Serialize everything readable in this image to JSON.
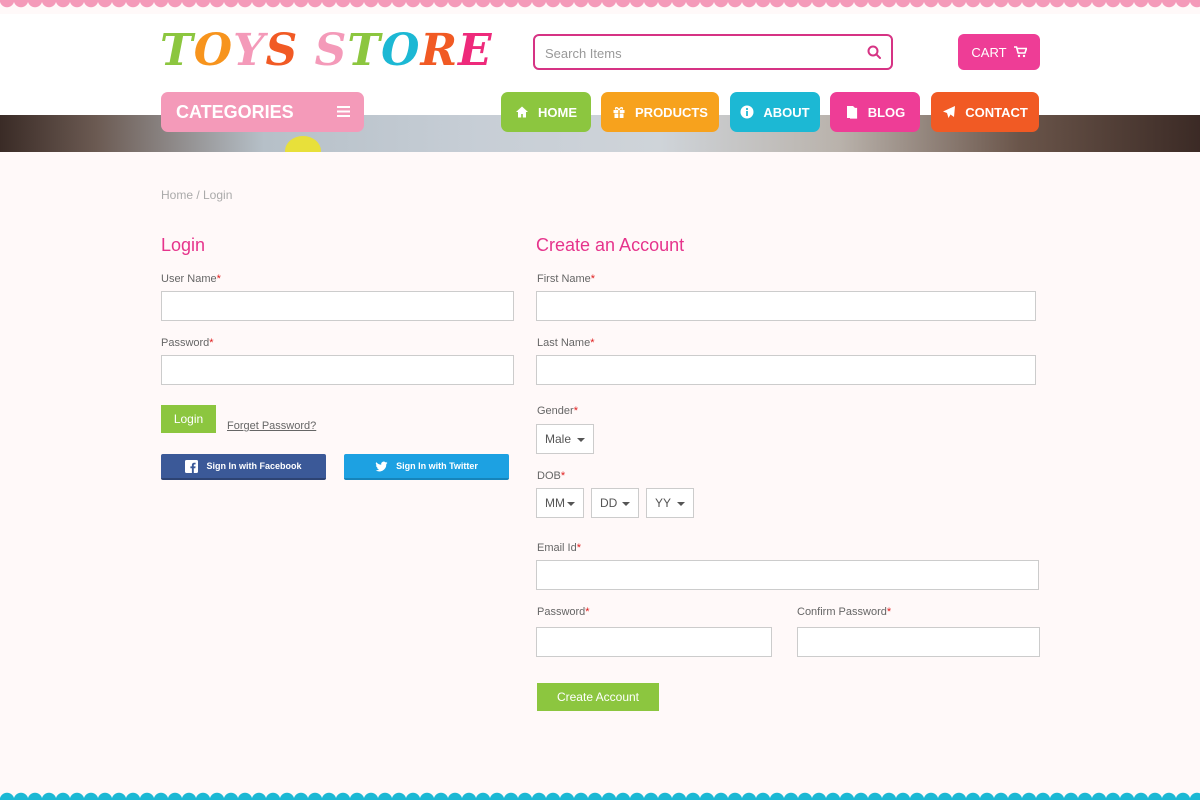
{
  "header": {
    "logo_text": "TOYS STORE",
    "search_placeholder": "Search Items",
    "cart_label": "CART"
  },
  "nav": {
    "categories_label": "CATEGORIES",
    "items": [
      {
        "label": "HOME",
        "icon": "home-icon",
        "color": "#8cc63f"
      },
      {
        "label": "PRODUCTS",
        "icon": "gift-icon",
        "color": "#f7a21d"
      },
      {
        "label": "ABOUT",
        "icon": "info-icon",
        "color": "#1cb8d4"
      },
      {
        "label": "BLOG",
        "icon": "document-icon",
        "color": "#ee3d96"
      },
      {
        "label": "CONTACT",
        "icon": "paper-plane-icon",
        "color": "#f15a24"
      }
    ]
  },
  "breadcrumb": "Home / Login",
  "login": {
    "title": "Login",
    "username_label": "User Name",
    "password_label": "Password",
    "login_button": "Login",
    "forget_password": "Forget Password?",
    "facebook_button": "Sign In with Facebook",
    "twitter_button": "Sign In with Twitter"
  },
  "register": {
    "title": "Create an Account",
    "first_name_label": "First Name",
    "last_name_label": "Last Name",
    "gender_label": "Gender",
    "gender_value": "Male",
    "dob_label": "DOB",
    "dob_month": "MM",
    "dob_day": "DD",
    "dob_year": "YY",
    "email_label": "Email Id",
    "password_label": "Password",
    "confirm_password_label": "Confirm Password",
    "submit_button": "Create Account"
  },
  "required_marker": "*",
  "colors": {
    "accent_pink": "#e6348c",
    "button_green": "#8cc63f",
    "scallop_top": "#f49ab9",
    "scallop_bottom": "#1cb8d4"
  }
}
